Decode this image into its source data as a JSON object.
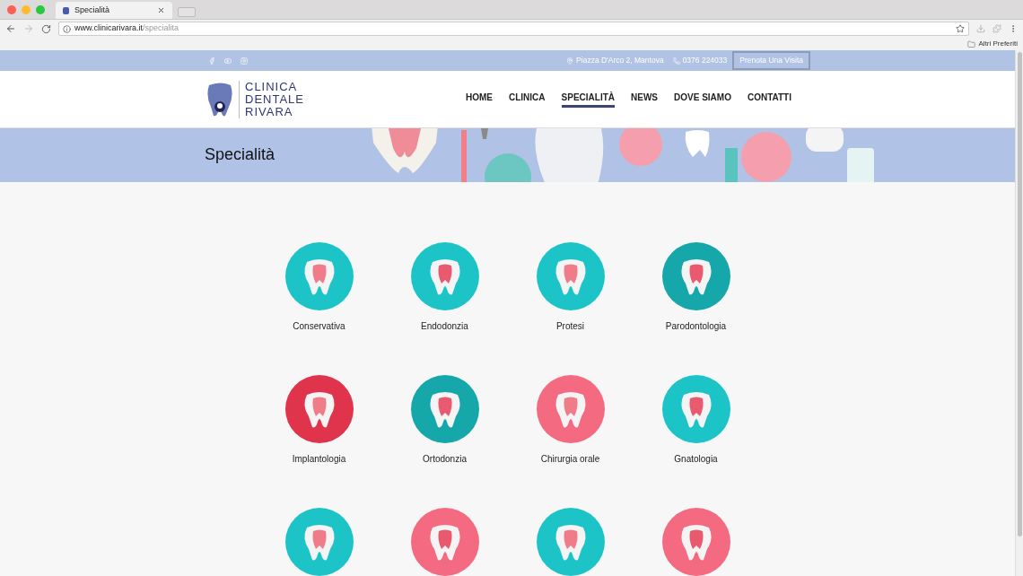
{
  "browser": {
    "tab": {
      "title": "Specialità"
    },
    "url": {
      "host": "www.clinicarivara.it",
      "path": "/specialita"
    },
    "bookmarks": [
      "Altri Preferiti"
    ]
  },
  "topbar": {
    "address": "Piazza D'Arco 2, Mantova",
    "phone": "0376 224033",
    "cta": "Prenota Una Visita"
  },
  "logo": {
    "lines": [
      "CLINICA",
      "DENTALE",
      "RIVARA"
    ]
  },
  "nav": [
    {
      "label": "HOME",
      "selected": false
    },
    {
      "label": "CLINICA",
      "selected": false
    },
    {
      "label": "SPECIALITÀ",
      "selected": true
    },
    {
      "label": "NEWS",
      "selected": false
    },
    {
      "label": "DOVE SIAMO",
      "selected": false
    },
    {
      "label": "CONTATTI",
      "selected": false
    }
  ],
  "banner": {
    "title": "Specialità"
  },
  "specialties": [
    {
      "label": "Conservativa",
      "color": "#1cc4c7"
    },
    {
      "label": "Endodonzia",
      "color": "#1cc4c7"
    },
    {
      "label": "Protesi",
      "color": "#1cc4c7"
    },
    {
      "label": "Parodontologia",
      "color": "#15a7aa"
    },
    {
      "label": "Implantologia",
      "color": "#e0334c"
    },
    {
      "label": "Ortodonzia",
      "color": "#15a7aa"
    },
    {
      "label": "Chirurgia orale",
      "color": "#f46b81"
    },
    {
      "label": "Gnatologia",
      "color": "#1cc4c7"
    },
    {
      "color": "#1cc4c7"
    },
    {
      "color": "#f46b81"
    },
    {
      "color": "#1cc4c7"
    },
    {
      "color": "#f46b81"
    }
  ]
}
